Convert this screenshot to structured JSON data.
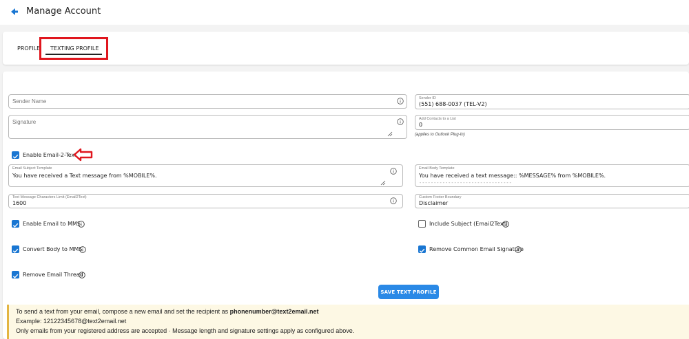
{
  "header": {
    "title": "Manage Account"
  },
  "tabs": [
    {
      "label": "PROFILE"
    },
    {
      "label": "TEXTING PROFILE"
    }
  ],
  "form": {
    "sender_name": {
      "placeholder": "Sender Name"
    },
    "signature": {
      "placeholder": "Signature"
    },
    "sender_id": {
      "label": "Sender ID",
      "value": "(551) 688-0037 (TEL-V2)"
    },
    "add_contacts": {
      "label": "Add Contacts to a List",
      "value": "0",
      "helper": "(applies to Outlook Plug-In)"
    },
    "enable_email2text": {
      "label": "Enable Email-2-Text",
      "checked": true
    },
    "email_subject_template": {
      "label": "Email Subject Template",
      "value": "You have received a Text message from %MOBILE%."
    },
    "email_body_template": {
      "label": "Email Body Template",
      "value": "You have received a text message:: %MESSAGE% from %MOBILE%.",
      "divider": "--------------------------------"
    },
    "char_limit": {
      "label": "Text Message Characters Limit (Email2Text)",
      "value": "1600"
    },
    "footer_boundary": {
      "label": "Custom Footer Boundary",
      "value": "Disclaimer"
    },
    "enable_email_mms": {
      "label": "Enable Email to MMS",
      "checked": true
    },
    "include_subject": {
      "label": "Include Subject (Email2Text)",
      "checked": false
    },
    "convert_body_mms": {
      "label": "Convert Body to MMS",
      "checked": true
    },
    "remove_signature": {
      "label": "Remove Common Email Signature",
      "checked": true
    },
    "remove_thread": {
      "label": "Remove Email Thread",
      "checked": true
    }
  },
  "save_button": {
    "label": "SAVE TEXT PROFILE"
  },
  "notice": {
    "line1_prefix": "To send a text from your email, compose a new email and set the recipient as ",
    "line1_bold": "phonenumber@text2email.net",
    "line2": "Example: 12122345678@text2email.net",
    "line3": "Only emails from your registered address are accepted · Message length and signature settings apply as configured above."
  },
  "colors": {
    "accent": "#1976d2",
    "button": "#2a89e6",
    "highlight": "#e0161e",
    "notice_bg": "#fdf8e4"
  }
}
